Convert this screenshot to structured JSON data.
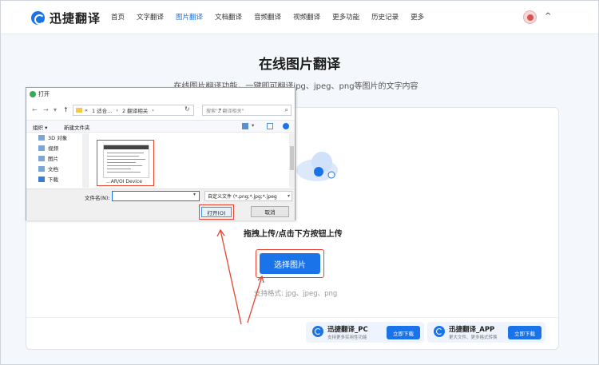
{
  "nav": {
    "brand": "迅捷翻译",
    "items": [
      {
        "label": "首页",
        "active": false
      },
      {
        "label": "文字翻译",
        "active": false
      },
      {
        "label": "图片翻译",
        "active": true
      },
      {
        "label": "文档翻译",
        "active": false
      },
      {
        "label": "音频翻译",
        "active": false
      },
      {
        "label": "视频翻译",
        "active": false
      },
      {
        "label": "更多功能",
        "active": false
      },
      {
        "label": "历史记录",
        "active": false
      },
      {
        "label": "更多",
        "active": false
      }
    ],
    "collapse_glyph": "^"
  },
  "page": {
    "title": "在线图片翻译",
    "subtitle": "在线图片翻译功能，一键即可翻译jpg、jpeg、png等图片的文字内容"
  },
  "upload": {
    "drop_text": "拖拽上传/点击下方按钮上传",
    "select_button": "选择图片",
    "formats": "支持格式: jpg、jpeg、png"
  },
  "downloads": [
    {
      "name": "迅捷翻译_PC",
      "desc": "支持更多实用性功能",
      "button": "立即下载"
    },
    {
      "name": "迅捷翻译_APP",
      "desc": "更大文件、更多格式转换",
      "button": "立即下载"
    }
  ],
  "dialog": {
    "title": "打开",
    "breadcrumb": [
      "«",
      "1 适合...",
      "›",
      "2 翻译相关",
      "›"
    ],
    "search_placeholder": "搜索\"2 翻译相关\"",
    "toolbar": {
      "organize": "组织 ▾",
      "new_folder": "新建文件夹"
    },
    "tree": [
      "3D 对象",
      "视频",
      "图片",
      "文档",
      "下载"
    ],
    "file_name_label": "文件名(N):",
    "file_name_value": "",
    "filter": "自定义文件 (*.png;*.jpg;*.jpeg",
    "thumb_name": "...AR/OI Device",
    "open_button": "打开(O)",
    "cancel_button": "取消"
  },
  "colors": {
    "accent": "#1a73e8",
    "annotation": "#e8432f"
  }
}
